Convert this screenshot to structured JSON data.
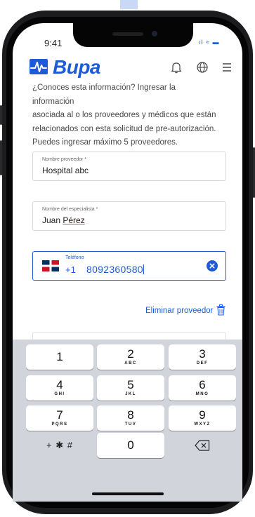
{
  "status_bar": {
    "time": "9:41",
    "indicators": "ıl ≈ ▬"
  },
  "header": {
    "brand": "Bupa",
    "bell_icon": "bell-icon",
    "globe_icon": "globe-icon",
    "menu_icon": "hamburger-menu-icon"
  },
  "intro": {
    "lines": [
      "¿Conoces esta información? Ingresar la información",
      "asociada al o los proveedores y médicos que están",
      "relacionados con esta solicitud de pre-autorización.",
      "Puedes ingresar máximo 5 proveedores."
    ]
  },
  "form": {
    "provider": {
      "label": "Nombre proveedor *",
      "value": "Hospital abc"
    },
    "specialist": {
      "label": "Nombre del especialista *",
      "value_first": "Juan",
      "value_last": "Pérez"
    },
    "phone": {
      "label": "Teléfono",
      "prefix": "+1",
      "number": "8092360580",
      "flag": "dominican-republic-flag"
    },
    "remove_provider": "Eliminar proveedor"
  },
  "keyboard": {
    "keys": [
      {
        "digit": "1",
        "letters": ""
      },
      {
        "digit": "2",
        "letters": "ABC"
      },
      {
        "digit": "3",
        "letters": "DEF"
      },
      {
        "digit": "4",
        "letters": "GHI"
      },
      {
        "digit": "5",
        "letters": "JKL"
      },
      {
        "digit": "6",
        "letters": "MNO"
      },
      {
        "digit": "7",
        "letters": "PQRS"
      },
      {
        "digit": "8",
        "letters": "TUV"
      },
      {
        "digit": "9",
        "letters": "WXYZ"
      }
    ],
    "symbols": "+ ✱ #",
    "zero": "0",
    "backspace_icon": "backspace-icon"
  },
  "colors": {
    "brand": "#1f5bd7",
    "keyboard_bg": "#d1d4db",
    "flag_red": "#ce1126",
    "flag_blue": "#002d62"
  }
}
